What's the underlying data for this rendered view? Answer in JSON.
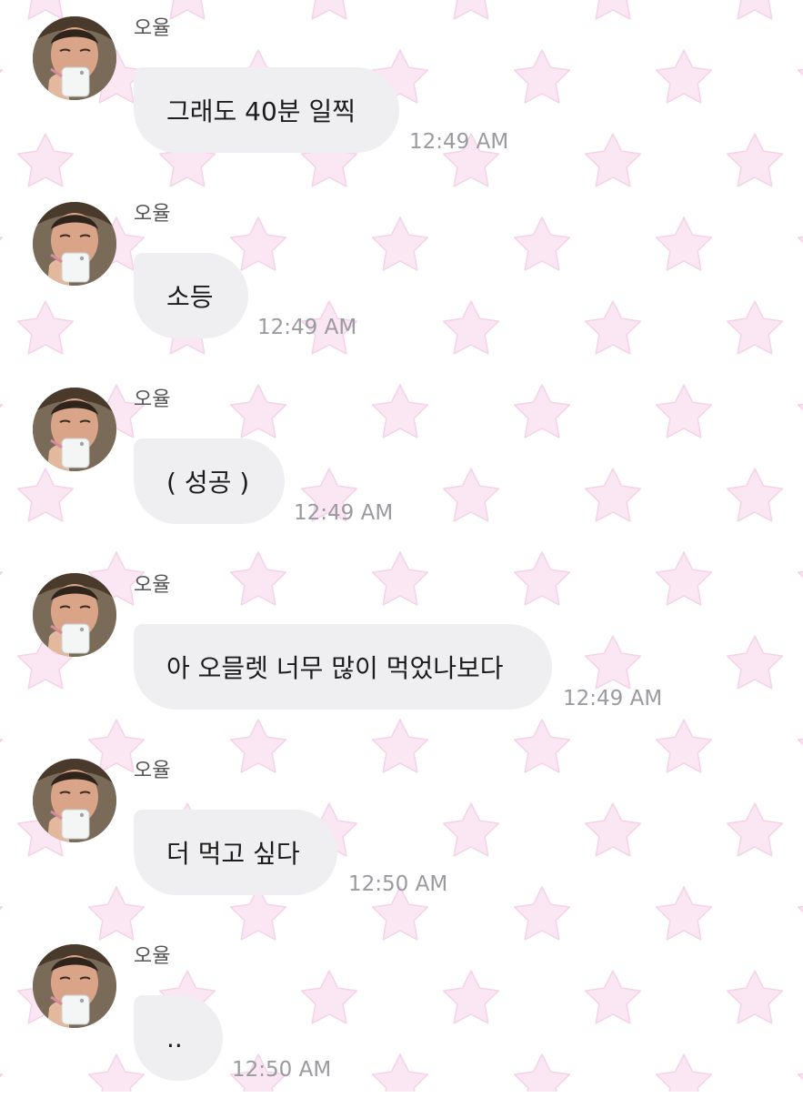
{
  "chat": {
    "messages": [
      {
        "sender": "오율",
        "text": "그래도 40분 일찍",
        "time": "12:49 AM"
      },
      {
        "sender": "오율",
        "text": "소등",
        "time": "12:49 AM"
      },
      {
        "sender": "오율",
        "text": "( 성공 )",
        "time": "12:49 AM"
      },
      {
        "sender": "오율",
        "text": "아 오믈렛 너무 많이 먹었나보다",
        "time": "12:49 AM"
      },
      {
        "sender": "오율",
        "text": "더 먹고 싶다",
        "time": "12:50 AM"
      },
      {
        "sender": "오율",
        "text": "..",
        "time": "12:50 AM"
      }
    ]
  },
  "theme": {
    "background": "#ffffff",
    "star_color": "#fbe6f3",
    "star_stroke": "#f3d3e8",
    "bubble_color": "#efeff1",
    "time_color": "#9a9aa0"
  }
}
